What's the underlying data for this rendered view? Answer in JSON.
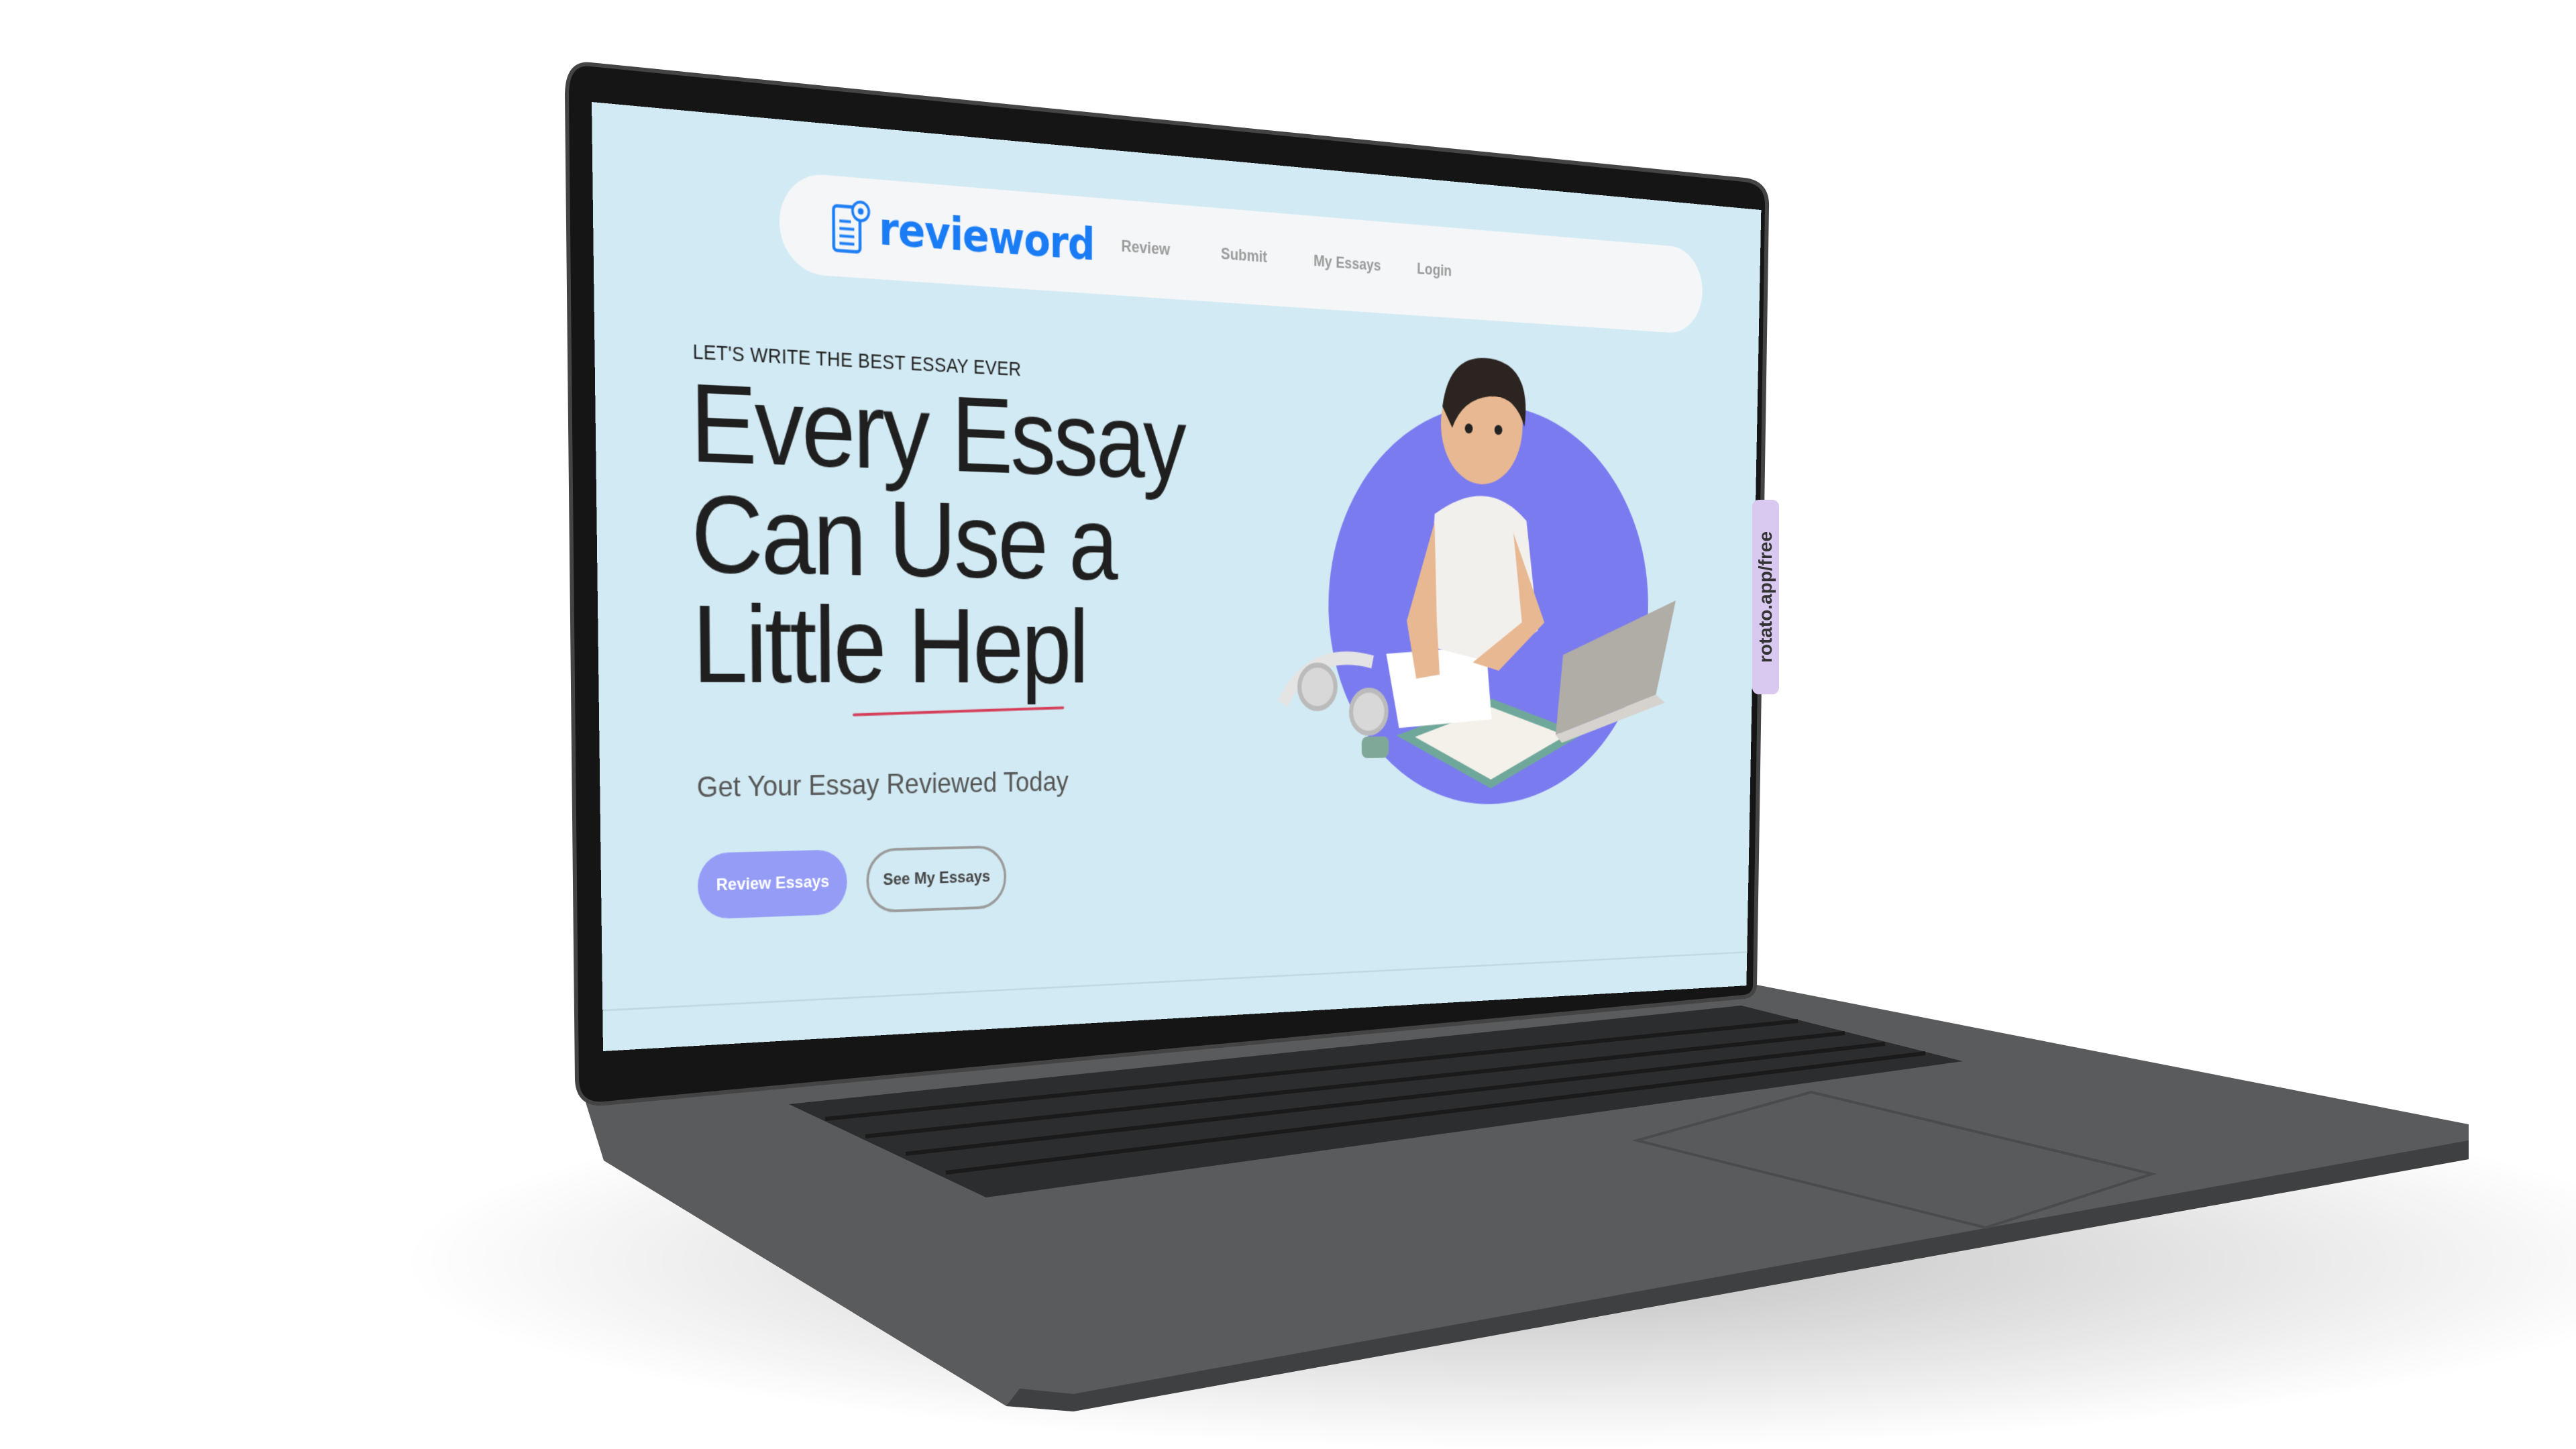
{
  "brand": {
    "name": "revieword",
    "color": "#1a7cf5",
    "icon": "document-eye-icon"
  },
  "nav": {
    "items": [
      {
        "label": "Review"
      },
      {
        "label": "Submit"
      },
      {
        "label": "My Essays"
      },
      {
        "label": "Login"
      }
    ]
  },
  "hero": {
    "tagline": "LET'S WRITE THE BEST ESSAY EVER",
    "heading_lines": [
      "Every Essay",
      "Can Use a",
      "Little Hepl"
    ],
    "subtitle": "Get Your Essay Reviewed Today",
    "primary_button": "Review Essays",
    "secondary_button": "See My Essays",
    "accent": "#949cf5",
    "underline_color": "#d63a55"
  },
  "watermark": "rotato.app/free",
  "colors": {
    "page_bg": "#d2eaf3",
    "nav_bg": "#f4f6f8",
    "circle": "#7b7bf0"
  }
}
